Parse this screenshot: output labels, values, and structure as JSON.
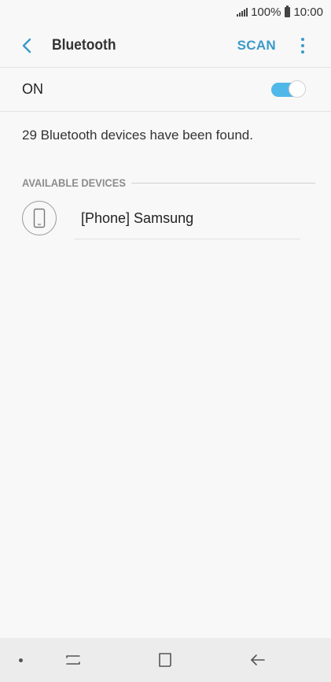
{
  "status_bar": {
    "battery": "100%",
    "time": "10:00"
  },
  "app_bar": {
    "title": "Bluetooth",
    "scan_label": "SCAN"
  },
  "toggle": {
    "label": "ON",
    "state": true,
    "accent_color": "#4fb8e8"
  },
  "found_message": "29 Bluetooth devices have been found.",
  "available_section": {
    "header": "AVAILABLE DEVICES",
    "devices": [
      {
        "name": "[Phone] Samsung",
        "icon": "phone-icon"
      }
    ]
  },
  "nav_bar": {
    "icons": [
      "recent-apps-icon",
      "home-icon",
      "back-icon"
    ]
  },
  "colors": {
    "accent": "#3a9ac9",
    "background": "#f8f8f8"
  }
}
